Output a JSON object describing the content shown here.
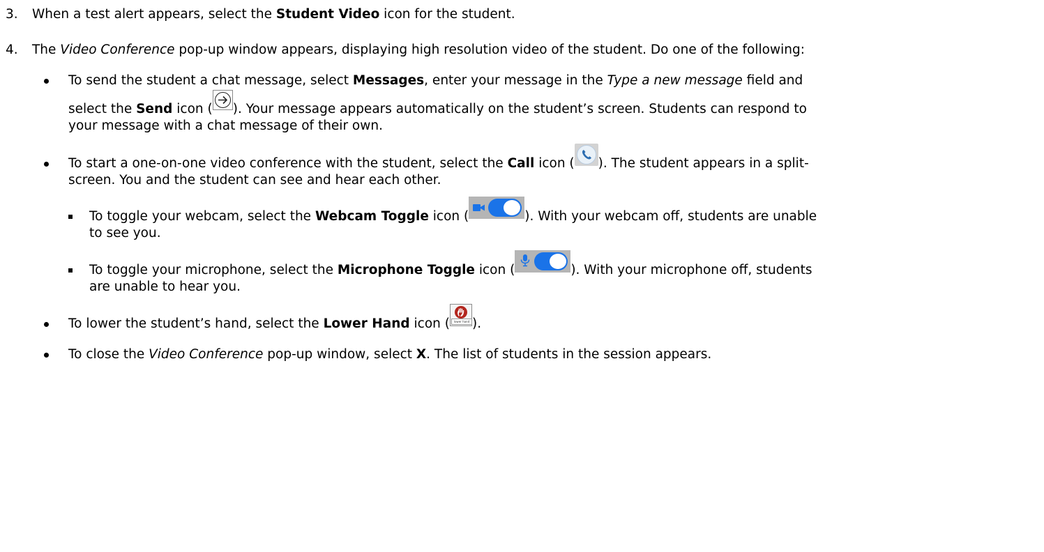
{
  "step3": {
    "number": "3.",
    "text_before": "When a test alert appears, select the ",
    "bold": "Student Video",
    "text_after": " icon for the student."
  },
  "step4": {
    "number": "4.",
    "text_before": "The ",
    "italic": "Video Conference",
    "text_after": " pop-up window appears, displaying high resolution video of the student. Do one of the following:"
  },
  "bullet_messages": {
    "l1_a": "To send the student a chat message, select ",
    "l1_bold": "Messages",
    "l1_b": ", enter your message in the ",
    "l1_italic": "Type a new message",
    "l1_c": " field and",
    "l2_a": "select the ",
    "l2_bold": "Send",
    "l2_b": " icon (",
    "l2_c": "). Your message appears automatically on the student’s screen. Students can respond to",
    "l3": "your message with a chat message of their own."
  },
  "bullet_call": {
    "l1_a": "To start a one-on-one video conference with the student, select the ",
    "l1_bold": "Call",
    "l1_b": " icon (",
    "l1_c": "). The student appears in a split-",
    "l2": "screen. You and the student can see and hear each other."
  },
  "sub_webcam": {
    "l1_a": "To toggle your webcam, select the ",
    "l1_bold": "Webcam Toggle",
    "l1_b": " icon (",
    "l1_c": "). With your webcam off, students are unable",
    "l2": "to see you."
  },
  "sub_microphone": {
    "l1_a": "To toggle your microphone, select the ",
    "l1_bold": "Microphone Toggle",
    "l1_b": " icon (",
    "l1_c": "). With your microphone off, students",
    "l2": "are unable to hear you."
  },
  "bullet_lower_hand": {
    "a": "To lower the student’s hand, select the ",
    "bold": "Lower Hand",
    "b": " icon (",
    "c": ").",
    "icon_label": "lower hand"
  },
  "bullet_close": {
    "a": "To close the ",
    "italic": "Video Conference",
    "b": " pop-up window, select ",
    "bold": "X",
    "c": ". The list of students in the session appears."
  },
  "icons": {
    "send": "send-arrow-icon",
    "call": "phone-call-icon",
    "webcam": "webcam-toggle-icon",
    "microphone": "microphone-toggle-icon",
    "lower_hand": "lower-hand-icon"
  },
  "colors": {
    "toggle_on": "#1a73e8",
    "hand_red": "#b3261e"
  }
}
